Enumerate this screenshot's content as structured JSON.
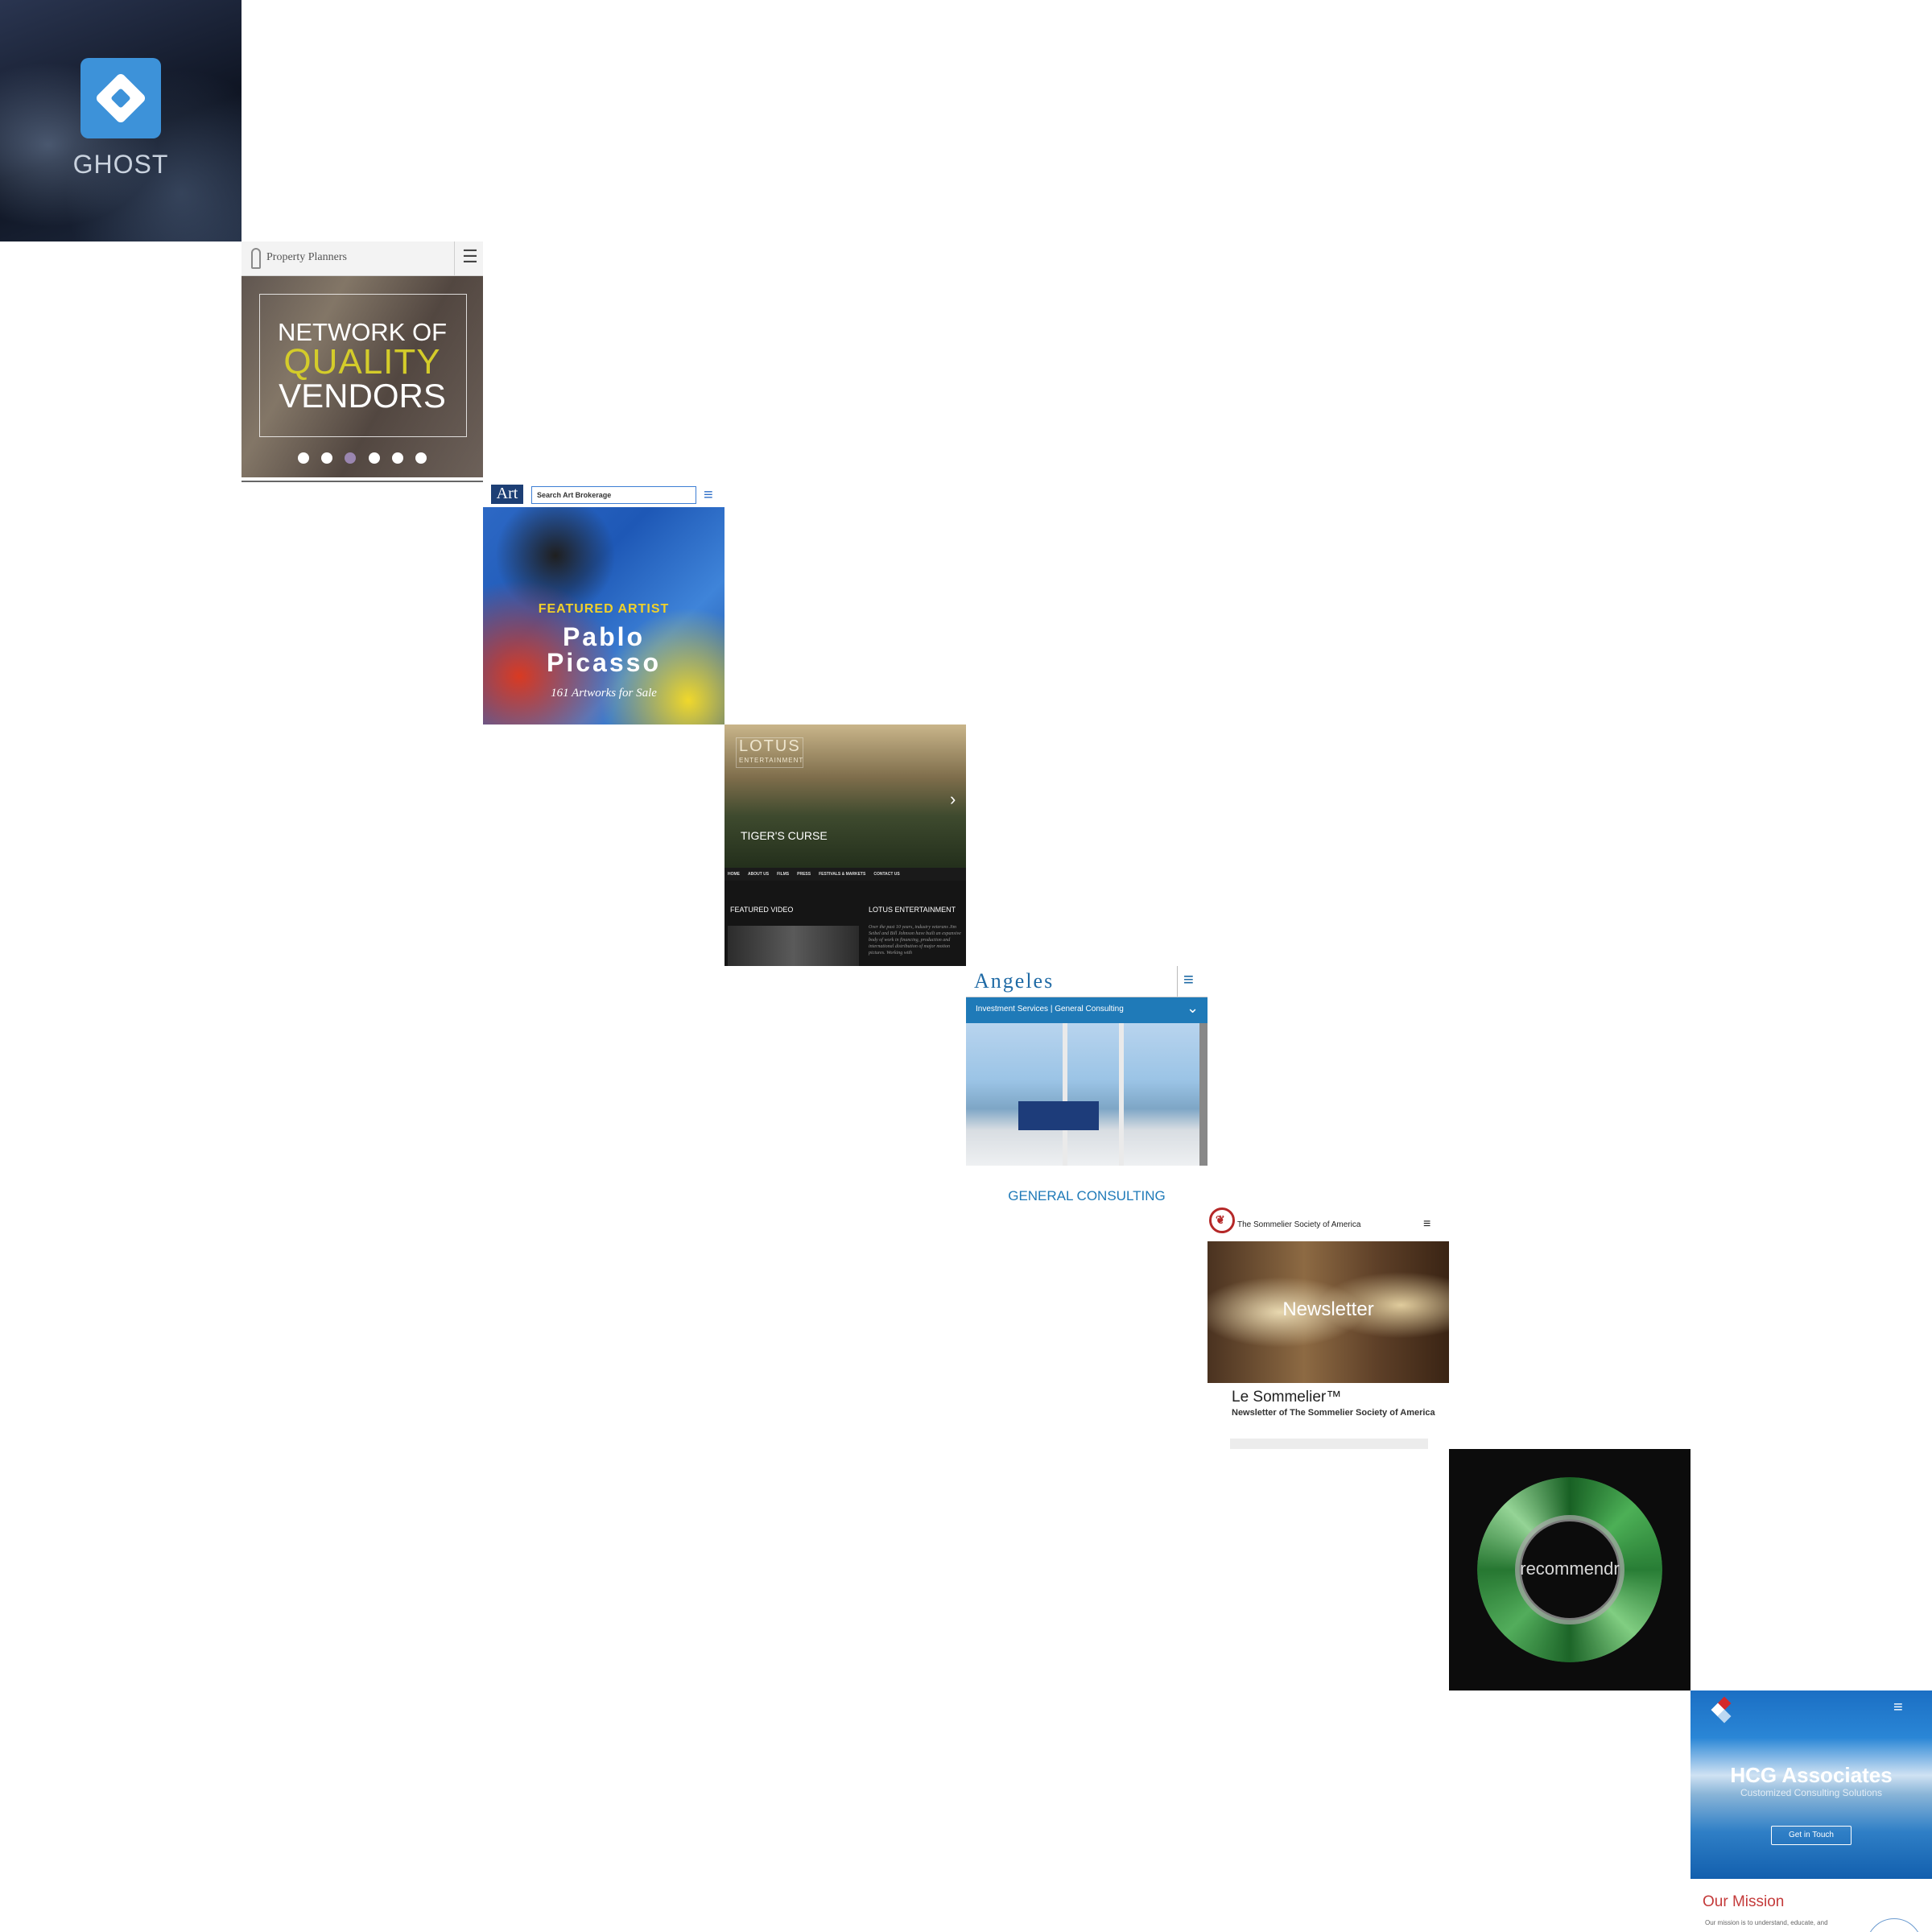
{
  "tiles": {
    "ghost": {
      "name": "GHOST"
    },
    "property": {
      "brand": "Property Planners",
      "menu_icon": "☰",
      "headline_1": "NETWORK OF",
      "headline_2": "QUALITY",
      "headline_3": "VENDORS",
      "active_dot": 3
    },
    "art": {
      "logo": "Art",
      "search_placeholder": "Search Art Brokerage",
      "menu_icon": "≡",
      "featured_label": "FEATURED ARTIST",
      "first_name": "Pablo",
      "last_name": "Picasso",
      "count": "161 Artworks for Sale"
    },
    "lotus": {
      "logo": "LOTUS",
      "logo_sub": "ENTERTAINMENT",
      "title": "TIGER'S CURSE",
      "next_arrow": "›",
      "nav": [
        "HOME",
        "ABOUT US",
        "FILMS",
        "PRESS",
        "FESTIVALS & MARKETS",
        "CONTACT US"
      ],
      "featured_video": "FEATURED VIDEO",
      "section_title": "LOTUS ENTERTAINMENT",
      "paragraph": "Over the past 10 years, industry veterans Jim Seibel and Bill Johnson have built an expansive body of work in financing, production and international distribution of major motion pictures. Working with"
    },
    "angeles": {
      "logo": "Angeles",
      "menu_icon": "≡",
      "subnav": "Investment Services | General Consulting",
      "chevron": "⌄",
      "section_title": "GENERAL CONSULTING"
    },
    "sommelier": {
      "seal_letter": "❦",
      "brand": "The Sommelier Society of America",
      "menu_icon": "≡",
      "hero_title": "Newsletter",
      "card_title": "Le Sommelier™",
      "card_subtitle": "Newsletter of The Sommelier Society of America"
    },
    "recommendr": {
      "word": "recommendr"
    },
    "hcg": {
      "menu_icon": "≡",
      "title": "HCG Associates",
      "tagline": "Customized Consulting Solutions",
      "cta": "Get in Touch",
      "mission_title": "Our Mission",
      "mission_text": "Our mission is to understand, educate, and"
    }
  }
}
